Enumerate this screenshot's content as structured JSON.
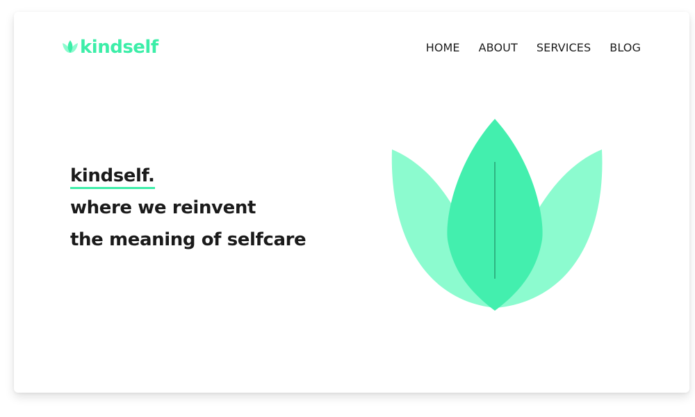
{
  "brand": {
    "name": "kindself",
    "color": "#3ceea8",
    "icon": "lotus-icon"
  },
  "nav": {
    "items": [
      {
        "label": "HOME"
      },
      {
        "label": "ABOUT"
      },
      {
        "label": "SERVICES"
      },
      {
        "label": "BLOG"
      }
    ]
  },
  "hero": {
    "brand_line": "kindself.",
    "line2": "where we reinvent",
    "line3": "the meaning of selfcare"
  },
  "illustration": {
    "icon": "lotus-icon",
    "petal_color_light": "#8cfbcf",
    "petal_color_main": "#43efae"
  }
}
